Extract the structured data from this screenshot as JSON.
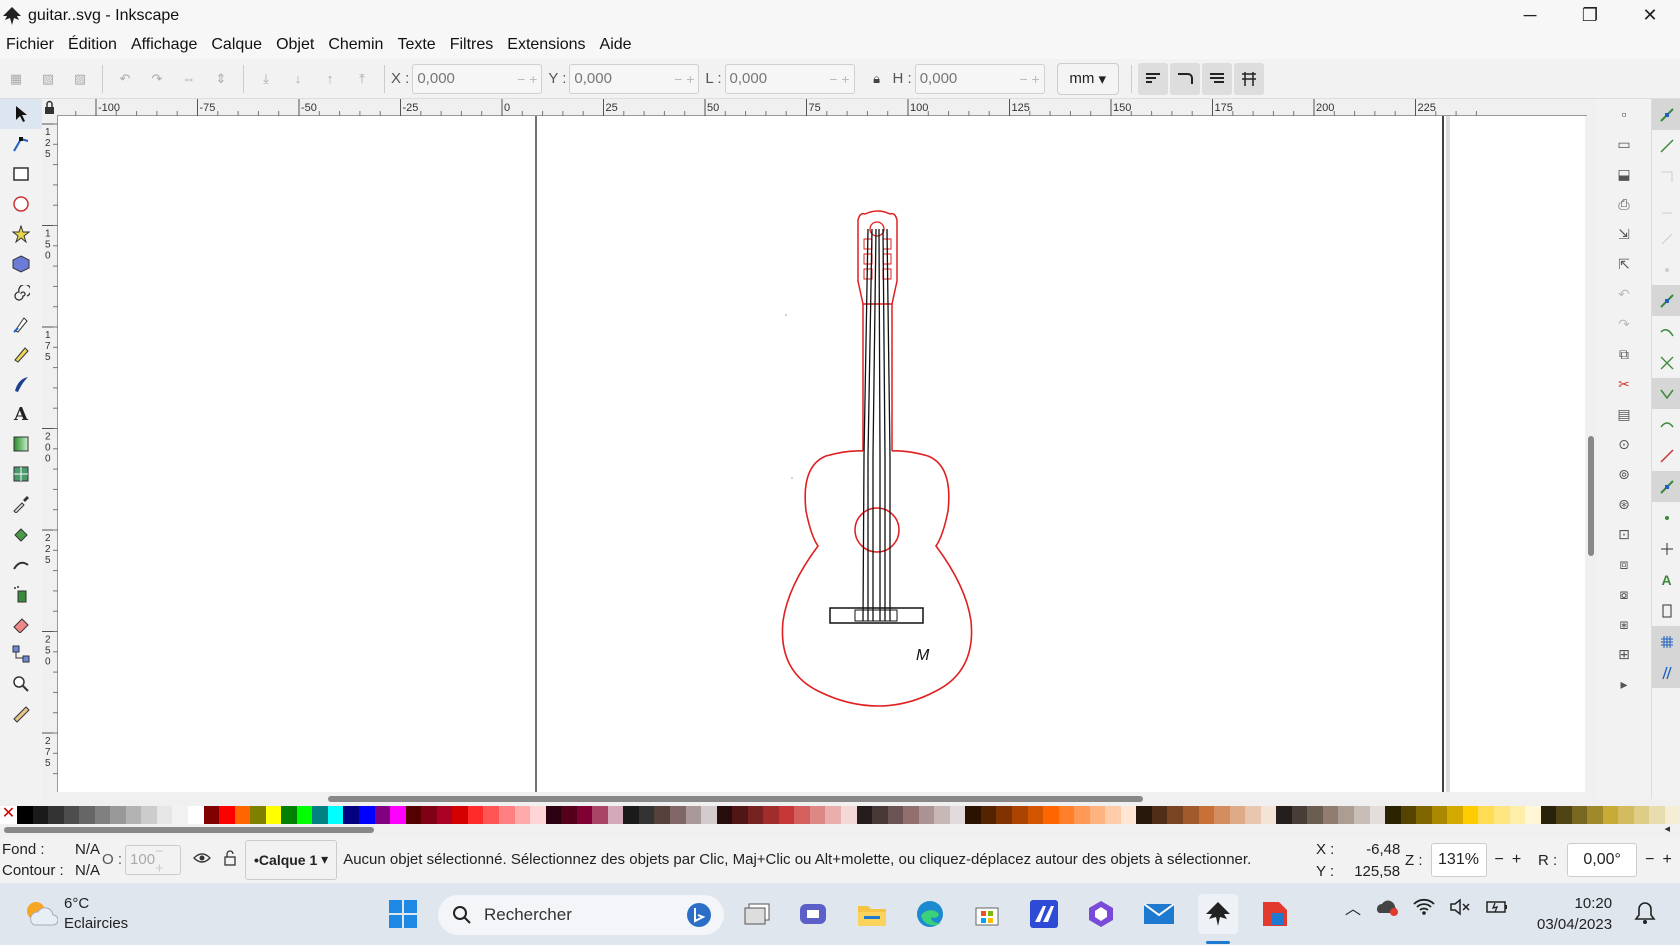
{
  "window": {
    "title": "guitar..svg - Inkscape",
    "controls": {
      "minimize": "─",
      "maximize": "❐",
      "close": "✕"
    }
  },
  "menu": [
    "Fichier",
    "Édition",
    "Affichage",
    "Calque",
    "Objet",
    "Chemin",
    "Texte",
    "Filtres",
    "Extensions",
    "Aide"
  ],
  "toolbar": {
    "x_label": "X :",
    "x_value": "0,000",
    "y_label": "Y :",
    "y_value": "0,000",
    "w_label": "L :",
    "w_value": "0,000",
    "h_label": "H :",
    "h_value": "0,000",
    "unit": "mm"
  },
  "ruler": {
    "h_labels": [
      "-100",
      "-75",
      "-50",
      "-25",
      "0",
      "25",
      "50",
      "75",
      "100",
      "125",
      "150",
      "175",
      "200",
      "225"
    ],
    "v_labels": [
      "125",
      "150",
      "175",
      "200",
      "225",
      "250",
      "275"
    ]
  },
  "canvas": {
    "drawing_label": "M",
    "stroke_colors": {
      "outline": "#e02020",
      "strings": "#111111"
    }
  },
  "statusbar": {
    "fill_label": "Fond :",
    "fill_value": "N/A",
    "stroke_label": "Contour :",
    "stroke_value": "N/A",
    "opacity_label": "O :",
    "opacity_value": "100",
    "layer": "•Calque 1",
    "message": "Aucun objet sélectionné. Sélectionnez des objets par Clic, Maj+Clic ou Alt+molette, ou cliquez-déplacez autour des objets à sélectionner.",
    "cursor_x_label": "X :",
    "cursor_x": "-6,48",
    "cursor_y_label": "Y :",
    "cursor_y": "125,58",
    "zoom_label": "Z :",
    "zoom": "131%",
    "rotation_label": "R :",
    "rotation": "0,00°"
  },
  "taskbar": {
    "temperature": "6°C",
    "weather": "Eclaircies",
    "search_placeholder": "Rechercher",
    "time": "10:20",
    "date": "03/04/2023"
  },
  "palette": [
    "#000000",
    "#1a1a1a",
    "#333333",
    "#4d4d4d",
    "#666666",
    "#808080",
    "#999999",
    "#b3b3b3",
    "#cccccc",
    "#e6e6e6",
    "#f2f2f2",
    "#ffffff",
    "#800000",
    "#ff0000",
    "#ff6600",
    "#808000",
    "#ffff00",
    "#008000",
    "#00ff00",
    "#008080",
    "#00ffff",
    "#000080",
    "#0000ff",
    "#800080",
    "#ff00ff",
    "#550000",
    "#800015",
    "#aa0022",
    "#d40000",
    "#ff2a2a",
    "#ff5555",
    "#ff8080",
    "#ffaaaa",
    "#ffd5d5",
    "#2b0011",
    "#55001a",
    "#800033",
    "#aa4466",
    "#d4aabb",
    "#1a1a1a",
    "#333333",
    "#55403a",
    "#806666",
    "#aa9999",
    "#d4cccc",
    "#280b0b",
    "#501616",
    "#782121",
    "#a02c2c",
    "#c83737",
    "#d35f5f",
    "#de8787",
    "#e9afaf",
    "#f4d7d7",
    "#241c1c",
    "#483737",
    "#6c5353",
    "#916f6f",
    "#ac9393",
    "#c8b7b7",
    "#e3dbdb",
    "#2b1100",
    "#552200",
    "#803300",
    "#aa4400",
    "#d45500",
    "#ff6600",
    "#ff7f2a",
    "#ff9955",
    "#ffb380",
    "#ffccaa",
    "#ffe6d5",
    "#28170b",
    "#502d16",
    "#784421",
    "#a05a2c",
    "#c87137",
    "#d38d5f",
    "#deaa87",
    "#e9c6af",
    "#f4e3d7",
    "#241f1c",
    "#483e37",
    "#6c5d53",
    "#917c6f",
    "#ac9d93",
    "#c8beb7",
    "#e3dedb",
    "#2b2200",
    "#554400",
    "#806600",
    "#aa8800",
    "#d4aa00",
    "#ffcc00",
    "#ffdd55",
    "#ffe680",
    "#ffeeaa",
    "#fff6d5",
    "#28220b",
    "#504416",
    "#786721",
    "#a0892c",
    "#c8ab37",
    "#d3bc5f",
    "#decd87",
    "#e9ddaf",
    "#f4eed7"
  ],
  "icons": {
    "app": "inkscape-icon",
    "tools": [
      "selector-icon",
      "node-icon",
      "rect-icon",
      "ellipse-icon",
      "star-icon",
      "3dbox-icon",
      "spiral-icon",
      "pen-icon",
      "pencil-icon",
      "calligraphy-icon",
      "text-icon",
      "gradient-icon",
      "mesh-icon",
      "dropper-icon",
      "paintbucket-icon",
      "tweak-icon",
      "spray-icon",
      "eraser-icon",
      "connector-icon",
      "zoom-icon",
      "measure-icon"
    ]
  }
}
